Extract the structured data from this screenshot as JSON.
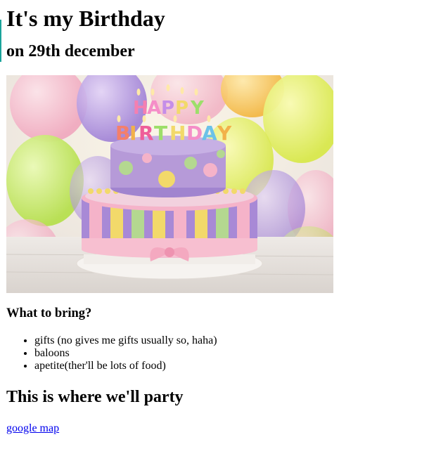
{
  "page": {
    "title": "It's my Birthday",
    "subtitle": "on 29th december"
  },
  "hero_image": {
    "alt": "Birthday cake",
    "cake_topper": "HAPPY BIRTHDAY",
    "colors": {
      "background_balloon_yellow": "#e8f26b",
      "background_balloon_purple": "#b89ee8",
      "background_balloon_pink": "#f5b8c8",
      "cake_top": "#b69ad8",
      "cake_bottom_purple": "#a889d6",
      "cake_stripe_yellow": "#f2d96a",
      "cake_stripe_pink": "#f5b3c9",
      "cake_stripe_green": "#b4d890",
      "ribbon_pink": "#f7bfd0",
      "plate": "#f4f0ec",
      "table": "#e9e4df"
    }
  },
  "bring": {
    "title": "What to bring?",
    "items": [
      "gifts (no gives me gifts usually so, haha)",
      "baloons",
      "apetite(ther'll be lots of food)"
    ]
  },
  "party": {
    "title": "This is where we'll party",
    "link_label": "google map"
  },
  "colors": {
    "link": "#0000ee",
    "accent_bar": "#1aa39a",
    "text": "#000000",
    "background": "#ffffff"
  }
}
